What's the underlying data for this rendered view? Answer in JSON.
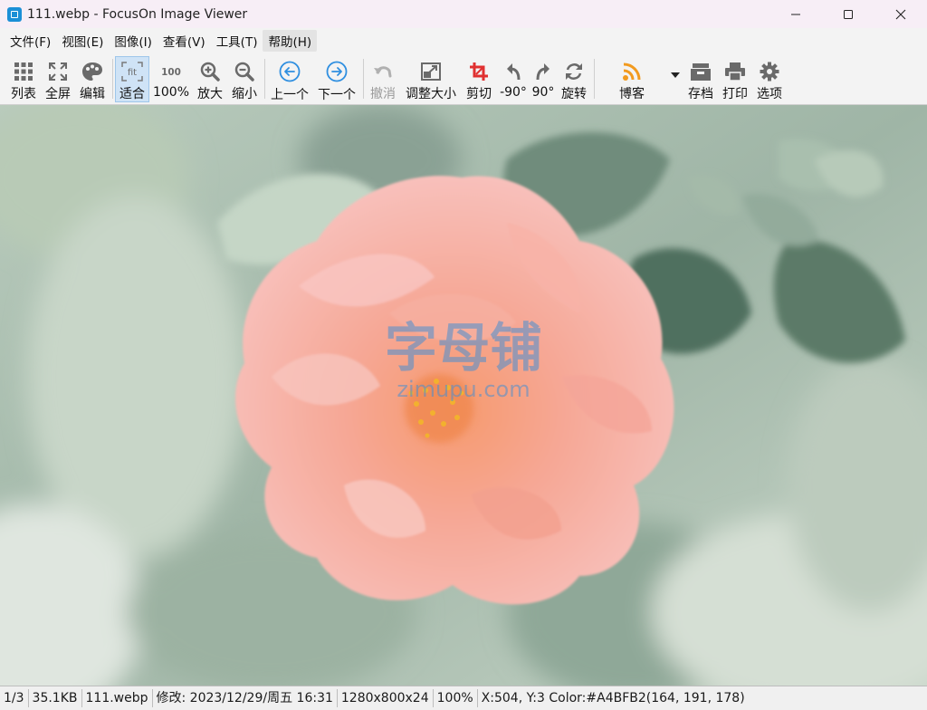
{
  "window": {
    "title": "111.webp - FocusOn Image Viewer"
  },
  "menu": {
    "items": [
      "文件(F)",
      "视图(E)",
      "图像(I)",
      "查看(V)",
      "工具(T)",
      "帮助(H)"
    ]
  },
  "toolbar": {
    "list": "列表",
    "fullscreen": "全屏",
    "edit": "编辑",
    "fit": "适合",
    "fit_icon_text": "fit",
    "zoom100": "100%",
    "zoom100_icon_text": "100",
    "zoom_in": "放大",
    "zoom_out": "缩小",
    "prev": "上一个",
    "next": "下一个",
    "undo": "撤消",
    "resize": "调整大小",
    "crop": "剪切",
    "rotate_left": "-90°",
    "rotate_right": "90°",
    "rotate": "旋转",
    "blog": "博客",
    "save": "存档",
    "print": "打印",
    "options": "选项"
  },
  "image": {
    "watermark_cn": "字母铺",
    "watermark_en": "zimupu.com"
  },
  "status": {
    "index": "1/3",
    "size": "35.1KB",
    "filename": "111.webp",
    "modified": "修改: 2023/12/29/周五 16:31",
    "dimensions": "1280x800x24",
    "zoom": "100%",
    "pixel_info": "X:504, Y:3 Color:#A4BFB2(164, 191, 178)"
  },
  "colors": {
    "accent": "#1b8fd6",
    "crop_red": "#e03030",
    "rss_orange": "#f29a1e"
  }
}
